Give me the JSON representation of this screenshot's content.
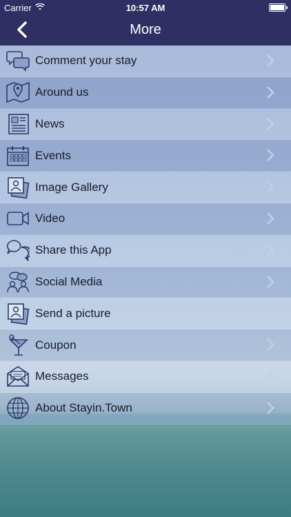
{
  "status": {
    "carrier": "Carrier",
    "time": "10:57 AM"
  },
  "nav": {
    "title": "More"
  },
  "menu": [
    {
      "label": "Comment your stay",
      "icon": "speech-bubbles-icon"
    },
    {
      "label": "Around us",
      "icon": "map-pin-icon"
    },
    {
      "label": "News",
      "icon": "newspaper-icon"
    },
    {
      "label": "Events",
      "icon": "calendar-icon"
    },
    {
      "label": "Image Gallery",
      "icon": "photo-gallery-icon"
    },
    {
      "label": "Video",
      "icon": "video-camera-icon"
    },
    {
      "label": "Share this App",
      "icon": "share-bubbles-icon"
    },
    {
      "label": "Social Media",
      "icon": "people-icon"
    },
    {
      "label": "Send a picture",
      "icon": "send-picture-icon"
    },
    {
      "label": "Coupon",
      "icon": "cocktail-icon"
    },
    {
      "label": "Messages",
      "icon": "envelope-icon"
    },
    {
      "label": "About Stayin.Town",
      "icon": "globe-icon"
    }
  ],
  "colors": {
    "bar": "#2f2f63",
    "icon": "#2b3a6b"
  }
}
